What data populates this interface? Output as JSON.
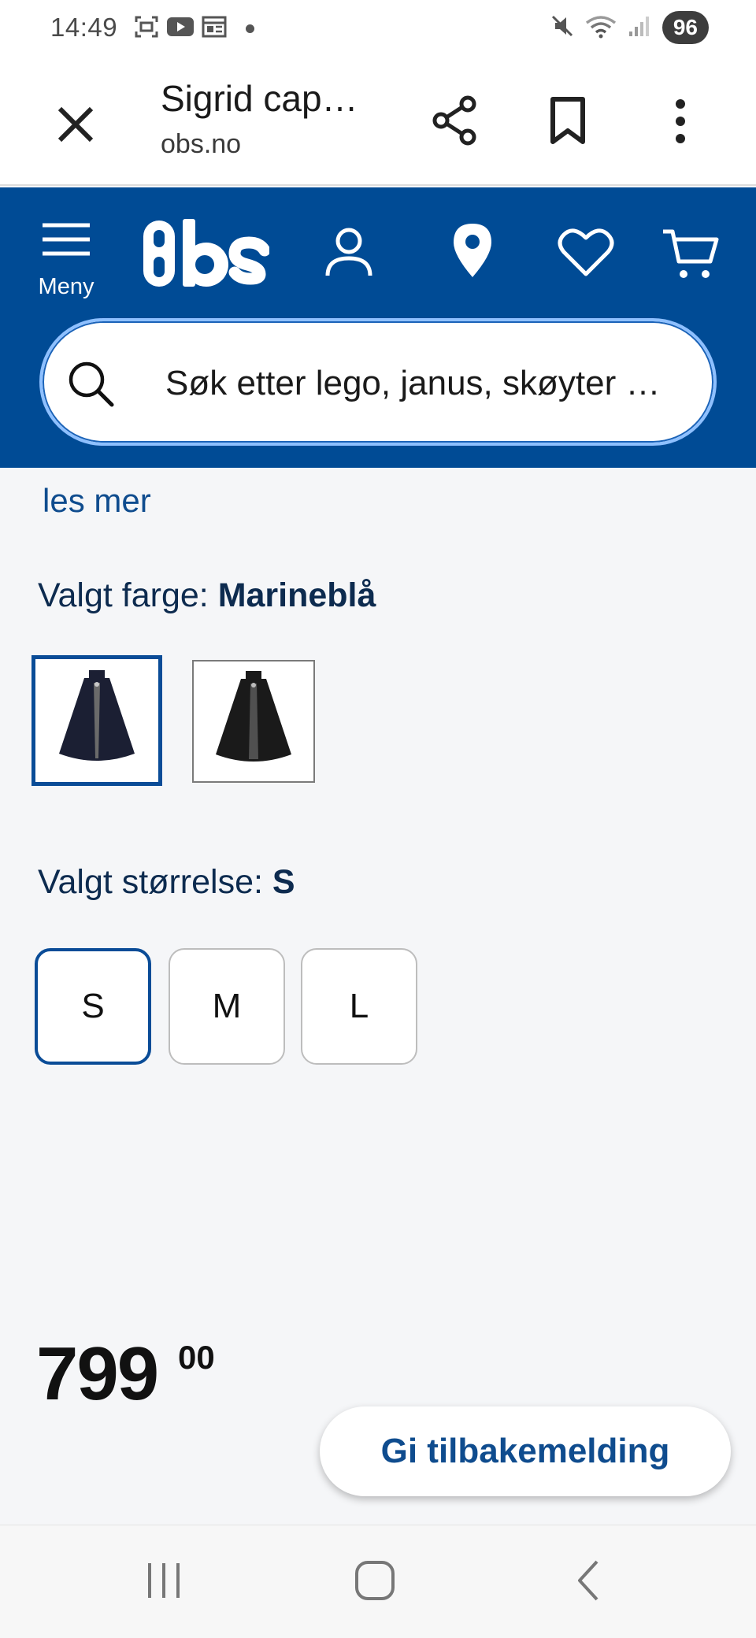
{
  "status_bar": {
    "time": "14:49",
    "battery": "96",
    "icons": [
      "screenshot-icon",
      "youtube-icon",
      "calendar-icon",
      "mute-icon",
      "wifi-icon",
      "signal-icon"
    ]
  },
  "browser": {
    "tab_title": "Sigrid cap…",
    "url": "obs.no"
  },
  "header": {
    "menu_label": "Meny",
    "logo_text": "Obs",
    "search_placeholder": "Søk etter lego, janus, skøyter …"
  },
  "product": {
    "read_more": "les mer",
    "color_label": "Valgt farge:",
    "color_value": "Marineblå",
    "size_label": "Valgt størrelse:",
    "size_value": "S",
    "sizes": [
      "S",
      "M",
      "L"
    ],
    "price_main": "799",
    "price_cents": "00"
  },
  "feedback": {
    "label": "Gi tilbakemelding"
  },
  "colors": {
    "brand_blue": "#004b95",
    "link_blue": "#0f4c8e",
    "selected_border": "#0a4c97"
  }
}
